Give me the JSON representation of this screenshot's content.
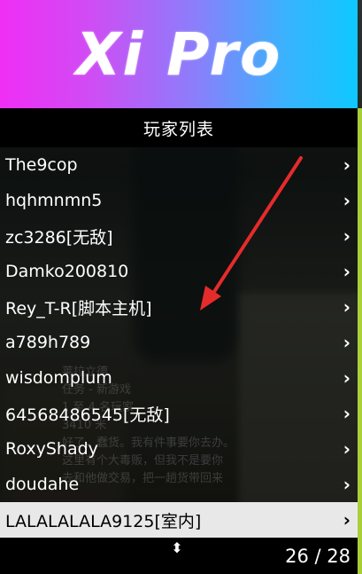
{
  "banner": {
    "title": "Xi Pro"
  },
  "menu": {
    "header": "玩家列表",
    "items": [
      {
        "label": "The9cop"
      },
      {
        "label": "hqhmnmn5"
      },
      {
        "label": "zc3286[无敌]"
      },
      {
        "label": "Damko200810"
      },
      {
        "label": "Rey_T-R[脚本主机]"
      },
      {
        "label": "a789h789"
      },
      {
        "label": "wisdomplum"
      },
      {
        "label": "64568486545[无敌]"
      },
      {
        "label": "RoxyShady"
      },
      {
        "label": "doudahe"
      },
      {
        "label": "LALALALALA9125[室内]",
        "selected": true
      }
    ],
    "chevron": "›",
    "footer": {
      "updown": "⬍",
      "counter": "26 / 28"
    }
  },
  "chat_overlay": {
    "lines": [
      "莱拉立德",
      "任务 - 新游戏",
      "1 至 4 名玩家",
      "3410 米",
      "好了，蠢货。我有件事要你去办。",
      "这里有个大毒贩，但我不是要你",
      "去和他做交易，把一趟货带回来"
    ]
  },
  "colors": {
    "banner_start": "#f02ef5",
    "banner_end": "#0ec8ff",
    "selected_row": "#e8e8e8",
    "annotation_arrow": "#e52b2b",
    "edge_highlight": "#b6e03a"
  },
  "icons": {
    "chevron": "chevron-right-icon",
    "scroll": "up-down-icon"
  }
}
